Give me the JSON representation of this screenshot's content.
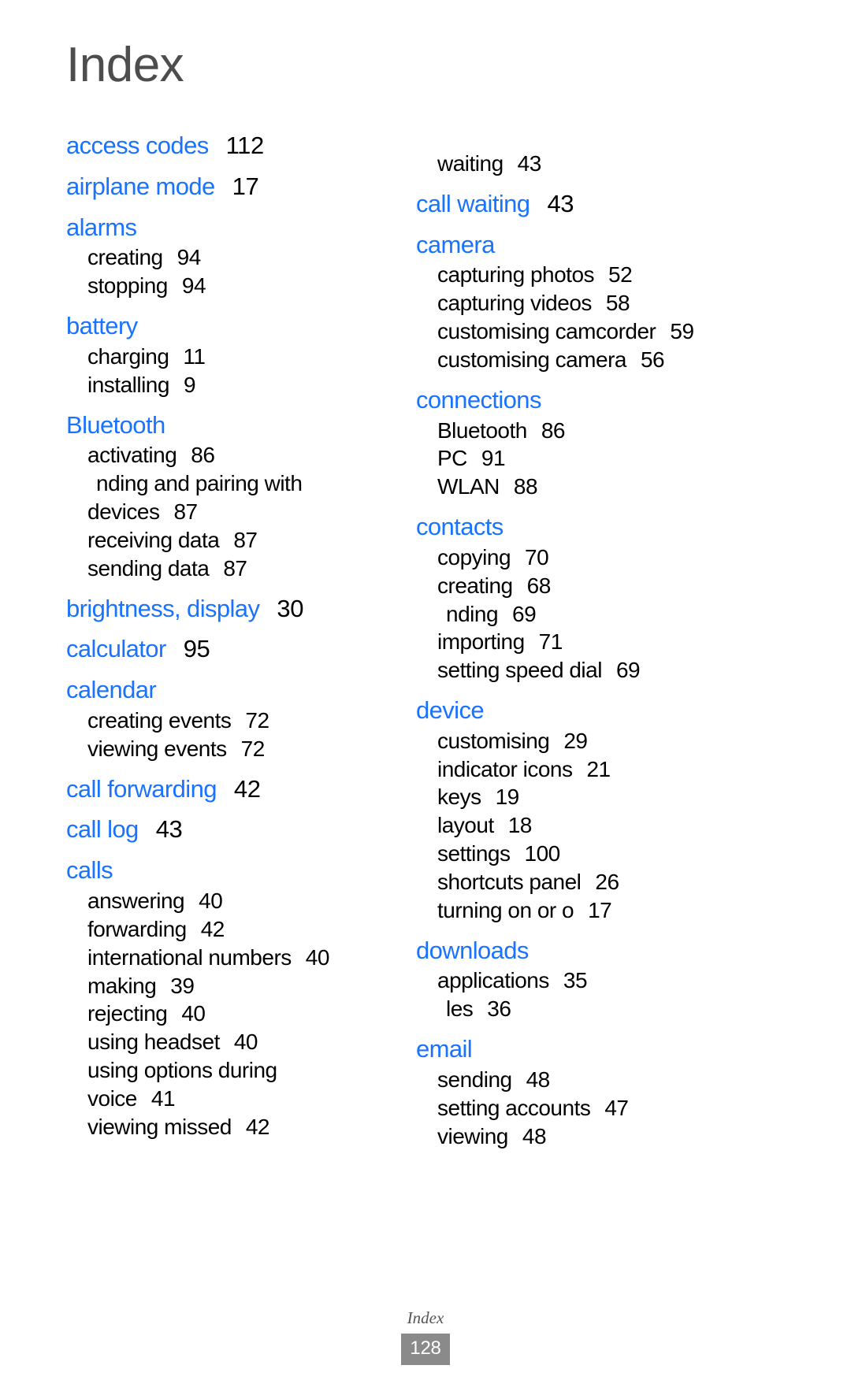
{
  "page": {
    "title": "Index",
    "footer_label": "Index",
    "footer_page_number": "128",
    "accent_color": "#1a73ff",
    "title_color": "#4d4d4d",
    "badge_color": "#8a8a8a"
  },
  "columns": [
    {
      "name": "left",
      "entries": [
        {
          "term": "access codes",
          "page": "112",
          "subentries": []
        },
        {
          "term": "airplane mode",
          "page": "17",
          "subentries": []
        },
        {
          "term": "alarms",
          "page": "",
          "subentries": [
            {
              "label": "creating",
              "page": "94"
            },
            {
              "label": "stopping",
              "page": "94"
            }
          ]
        },
        {
          "term": "battery",
          "page": "",
          "subentries": [
            {
              "label": "charging",
              "page": "11"
            },
            {
              "label": "installing",
              "page": "9"
            }
          ]
        },
        {
          "term": "Bluetooth",
          "page": "",
          "subentries": [
            {
              "label": "activating",
              "page": "86"
            },
            {
              "label": "nding and pairing with",
              "page": "",
              "indented": true
            },
            {
              "label": "devices",
              "page": "87"
            },
            {
              "label": "receiving data",
              "page": "87"
            },
            {
              "label": "sending data",
              "page": "87"
            }
          ]
        },
        {
          "term": "brightness, display",
          "page": "30",
          "subentries": []
        },
        {
          "term": "calculator",
          "page": "95",
          "subentries": []
        },
        {
          "term": "calendar",
          "page": "",
          "subentries": [
            {
              "label": "creating events",
              "page": "72"
            },
            {
              "label": "viewing events",
              "page": "72"
            }
          ]
        },
        {
          "term": "call forwarding",
          "page": "42",
          "subentries": []
        },
        {
          "term": "call log",
          "page": "43",
          "subentries": []
        },
        {
          "term": "calls",
          "page": "",
          "subentries": [
            {
              "label": "answering",
              "page": "40"
            },
            {
              "label": "forwarding",
              "page": "42"
            },
            {
              "label": "international numbers",
              "page": "40"
            },
            {
              "label": "making",
              "page": "39"
            },
            {
              "label": "rejecting",
              "page": "40"
            },
            {
              "label": "using headset",
              "page": "40"
            },
            {
              "label": "using options during",
              "page": ""
            },
            {
              "label": "voice",
              "page": "41"
            },
            {
              "label": "viewing missed",
              "page": "42"
            }
          ]
        }
      ]
    },
    {
      "name": "right",
      "entries": [
        {
          "term": "",
          "page": "",
          "subentries": [
            {
              "label": "waiting",
              "page": "43"
            }
          ]
        },
        {
          "term": "call waiting",
          "page": "43",
          "subentries": []
        },
        {
          "term": "camera",
          "page": "",
          "subentries": [
            {
              "label": "capturing photos",
              "page": "52"
            },
            {
              "label": "capturing videos",
              "page": "58"
            },
            {
              "label": "customising camcorder",
              "page": "59"
            },
            {
              "label": "customising camera",
              "page": "56"
            }
          ]
        },
        {
          "term": "connections",
          "page": "",
          "subentries": [
            {
              "label": "Bluetooth",
              "page": "86"
            },
            {
              "label": "PC",
              "page": "91"
            },
            {
              "label": "WLAN",
              "page": "88"
            }
          ]
        },
        {
          "term": "contacts",
          "page": "",
          "subentries": [
            {
              "label": "copying",
              "page": "70"
            },
            {
              "label": "creating",
              "page": "68"
            },
            {
              "label": "nding",
              "page": "69",
              "indented": true
            },
            {
              "label": "importing",
              "page": "71"
            },
            {
              "label": "setting speed dial",
              "page": "69"
            }
          ]
        },
        {
          "term": "device",
          "page": "",
          "subentries": [
            {
              "label": "customising",
              "page": "29"
            },
            {
              "label": "indicator icons",
              "page": "21"
            },
            {
              "label": "keys",
              "page": "19"
            },
            {
              "label": "layout",
              "page": "18"
            },
            {
              "label": "settings",
              "page": "100"
            },
            {
              "label": "shortcuts panel",
              "page": "26"
            },
            {
              "label": "turning on or o",
              "page": "17"
            }
          ]
        },
        {
          "term": "downloads",
          "page": "",
          "subentries": [
            {
              "label": "applications",
              "page": "35"
            },
            {
              "label": "les",
              "page": "36",
              "indented": true
            }
          ]
        },
        {
          "term": "email",
          "page": "",
          "subentries": [
            {
              "label": "sending",
              "page": "48"
            },
            {
              "label": "setting accounts",
              "page": "47"
            },
            {
              "label": "viewing",
              "page": "48"
            }
          ]
        }
      ]
    }
  ]
}
